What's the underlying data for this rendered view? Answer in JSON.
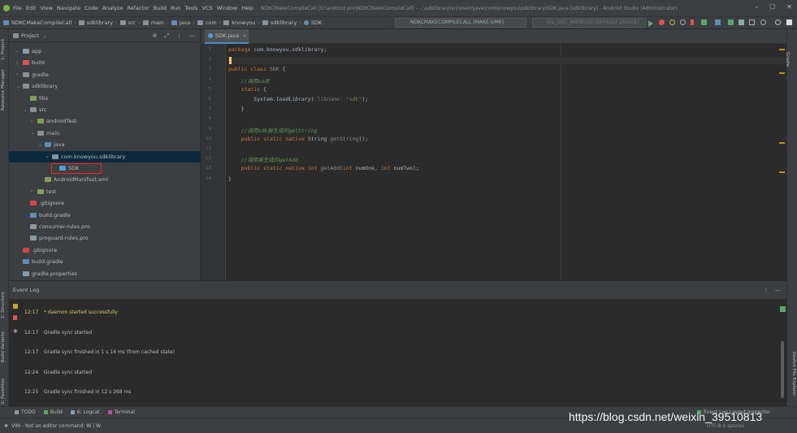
{
  "menubar": {
    "items": [
      "File",
      "Edit",
      "View",
      "Navigate",
      "Code",
      "Analyze",
      "Refactor",
      "Build",
      "Run",
      "Tools",
      "VCS",
      "Window",
      "Help"
    ],
    "title": "NDKCMakeCompileCall [G:\\android pro\\NDKCMakeCompileCall] - ...\\sdklibrary\\src\\main\\java\\com\\knowyou\\sdklibrary\\SDK.java [sdklibrary] - Android Studio (Administrator)",
    "window_buttons": [
      "–",
      "☐",
      "✕"
    ]
  },
  "navbar": {
    "crumbs": [
      "NDKCMakeCompileCall",
      "sdklibrary",
      "src",
      "main",
      "java",
      "com",
      "knowyou",
      "sdklibrary",
      "SDK"
    ],
    "run_config": "NDKCMAKECOMPILECALL [MAKE GMR]",
    "device": "SSL_DEC_ANDROID [DEFAULT DEVICE]"
  },
  "leftstrip": {
    "labels": [
      "1: Project",
      "Resource Manager",
      "2: Structure",
      "Build Variants",
      "2: Favorites"
    ]
  },
  "rightstrip": {
    "labels": [
      "Gradle",
      "Device File Explorer"
    ]
  },
  "project_panel": {
    "title": "Project",
    "tree": [
      {
        "label": "app",
        "indent": 1,
        "arrow": "›",
        "icon": "#8a9aa6"
      },
      {
        "label": "build",
        "indent": 1,
        "arrow": "›",
        "icon": "#e05252"
      },
      {
        "label": "gradle",
        "indent": 1,
        "arrow": "›",
        "icon": "#87939a"
      },
      {
        "label": "sdklibrary",
        "indent": 1,
        "arrow": "⌄",
        "icon": "#87939a"
      },
      {
        "label": "libs",
        "indent": 2,
        "arrow": "",
        "icon": "#7f9f5a"
      },
      {
        "label": "src",
        "indent": 2,
        "arrow": "⌄",
        "icon": "#87939a"
      },
      {
        "label": "androidTest",
        "indent": 3,
        "arrow": "›",
        "icon": "#7f9f5a"
      },
      {
        "label": "main",
        "indent": 3,
        "arrow": "⌄",
        "icon": "#87939a"
      },
      {
        "label": "java",
        "indent": 4,
        "arrow": "⌄",
        "icon": "#5e8eb8"
      },
      {
        "label": "com.knowyou.sdklibrary",
        "indent": 5,
        "arrow": "⌄",
        "icon": "#87939a",
        "selected": true
      },
      {
        "label": "SDK",
        "indent": 6,
        "arrow": "",
        "icon": "#4a9fd8",
        "highlighted": true
      },
      {
        "label": "AndroidManifest.xml",
        "indent": 4,
        "arrow": "",
        "icon": "#7f9f5a"
      },
      {
        "label": "test",
        "indent": 3,
        "arrow": "›",
        "icon": "#7f9f5a"
      },
      {
        "label": ".gitignore",
        "indent": 2,
        "arrow": "",
        "icon": "#d04646"
      },
      {
        "label": "build.gradle",
        "indent": 2,
        "arrow": "",
        "icon": "#5e8eb8"
      },
      {
        "label": "consumer-rules.pro",
        "indent": 2,
        "arrow": "",
        "icon": "#8a9aa6"
      },
      {
        "label": "proguard-rules.pro",
        "indent": 2,
        "arrow": "",
        "icon": "#8a9aa6"
      },
      {
        "label": ".gitignore",
        "indent": 1,
        "arrow": "",
        "icon": "#d04646"
      },
      {
        "label": "build.gradle",
        "indent": 1,
        "arrow": "",
        "icon": "#5e8eb8"
      },
      {
        "label": "gradle.properties",
        "indent": 1,
        "arrow": "",
        "icon": "#8a9aa6"
      }
    ]
  },
  "editor": {
    "tab": "SDK.java",
    "line_numbers": [
      "1",
      "2",
      "3",
      "4",
      "5",
      "6",
      "7",
      "8",
      "9",
      "10",
      "11",
      "12",
      "13",
      "14"
    ],
    "lines": [
      [
        {
          "t": "package ",
          "c": "kw"
        },
        {
          "t": "com.knowyou.sdklibrary;",
          "c": "pkg"
        }
      ],
      [],
      [
        {
          "t": "public class ",
          "c": "kw"
        },
        {
          "t": "SDK ",
          "c": "gray"
        },
        {
          "t": "{",
          "c": "pkg"
        }
      ],
      [
        {
          "t": "    //调用so库",
          "c": "cm"
        }
      ],
      [
        {
          "t": "    static ",
          "c": "kw"
        },
        {
          "t": "{",
          "c": "pkg"
        }
      ],
      [
        {
          "t": "        System.",
          "c": "pkg"
        },
        {
          "t": "loadLibrary",
          "c": "it"
        },
        {
          "t": "( ",
          "c": "pkg"
        },
        {
          "t": "libname: ",
          "c": "hint"
        },
        {
          "t": "\"sdk\"",
          "c": "str"
        },
        {
          "t": ");",
          "c": "pkg"
        }
      ],
      [
        {
          "t": "    }",
          "c": "pkg"
        }
      ],
      [],
      [
        {
          "t": "    //调用sdk层生成的getString",
          "c": "cm"
        }
      ],
      [
        {
          "t": "    public static native ",
          "c": "kw"
        },
        {
          "t": "String ",
          "c": "pkg"
        },
        {
          "t": "getString",
          "c": "gray"
        },
        {
          "t": "();",
          "c": "pkg"
        }
      ],
      [],
      [
        {
          "t": "    //调用层生成的getAdd",
          "c": "cm"
        }
      ],
      [
        {
          "t": "    public static native int ",
          "c": "kw"
        },
        {
          "t": "getAdd",
          "c": "gray"
        },
        {
          "t": "(",
          "c": "pkg"
        },
        {
          "t": "int ",
          "c": "kw"
        },
        {
          "t": "numOne, ",
          "c": "pkg"
        },
        {
          "t": "int ",
          "c": "kw"
        },
        {
          "t": "numTwo);",
          "c": "pkg"
        }
      ],
      [
        {
          "t": "}",
          "c": "pkg"
        }
      ]
    ]
  },
  "event_log": {
    "title": "Event Log",
    "entries": [
      {
        "time": "12:17",
        "text": "* daemon started successfully",
        "highlight": true
      },
      {
        "time": "12:17",
        "text": "Gradle sync started"
      },
      {
        "time": "12:17",
        "text": "Gradle sync finished in 1 s 14 ms (from cached state)"
      },
      {
        "time": "12:24",
        "text": "Gradle sync started"
      },
      {
        "time": "12:25",
        "text": "Gradle sync finished in 12 s 268 ms"
      }
    ]
  },
  "bottom_tools": [
    "TODO",
    "Build",
    "6: Logcat",
    "Terminal"
  ],
  "status": {
    "text": "VIM - Not an editor command: W | W",
    "right": "Event Log  Layout Inspector",
    "encoding": "UTF-8  4 spaces"
  },
  "watermark": "https://blog.csdn.net/weixin_39510813",
  "colors": {
    "accent": "#4a88c7",
    "selection_box": "#ff2020",
    "background": "#2b2b2b",
    "panel": "#3c3f41"
  }
}
